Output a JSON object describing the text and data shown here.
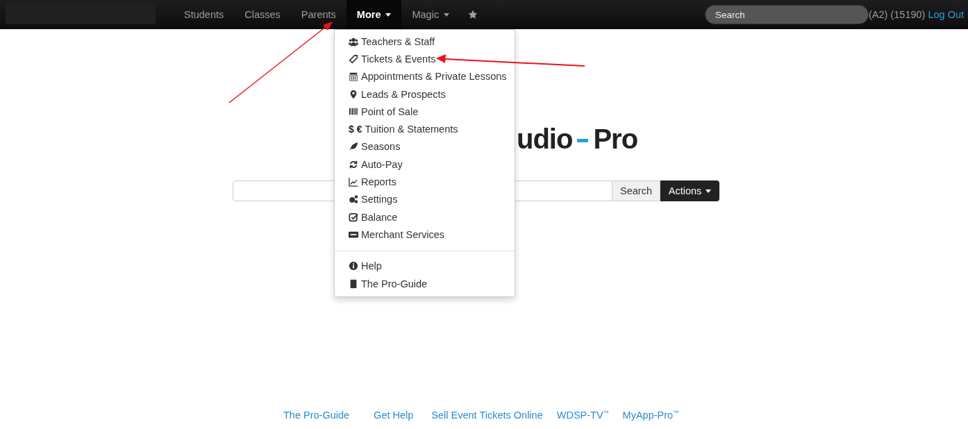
{
  "navbar": {
    "items": [
      {
        "kind": "link",
        "label": "Students",
        "selected": false,
        "caret": false
      },
      {
        "kind": "link",
        "label": "Classes",
        "selected": false,
        "caret": false
      },
      {
        "kind": "link",
        "label": "Parents",
        "selected": false,
        "caret": false
      },
      {
        "kind": "link",
        "label": "More",
        "selected": true,
        "caret": true
      },
      {
        "kind": "link",
        "label": "Magic",
        "selected": false,
        "caret": true
      },
      {
        "kind": "icon",
        "selected": false,
        "caret": false
      }
    ],
    "search": {
      "placeholder": "Search"
    },
    "account": "(A2) (15190)",
    "logout": "Log Out"
  },
  "dropdown": {
    "groups": [
      [
        {
          "label": "Teachers & Staff"
        },
        {
          "label": "Tickets & Events"
        },
        {
          "label": "Appointments & Private Lessons"
        },
        {
          "label": "Leads & Prospects"
        },
        {
          "label": "Point of Sale"
        },
        {
          "icon_text": "$ €",
          "label": "Tuition & Statements"
        },
        {
          "label": "Seasons"
        },
        {
          "label": "Auto-Pay"
        },
        {
          "label": "Reports"
        },
        {
          "label": "Settings"
        },
        {
          "label": "Balance"
        },
        {
          "label": "Merchant Services"
        }
      ],
      [
        {
          "label": "Help"
        },
        {
          "label": "The Pro-Guide"
        }
      ]
    ]
  },
  "logo": {
    "left": "udio",
    "right": "Pro"
  },
  "search_bar": {
    "button": "Search",
    "actions": "Actions"
  },
  "footer": {
    "links": [
      "The Pro-Guide",
      "Get Help",
      "Sell Event Tickets Online",
      "WDSP-TV$^{™}$",
      "MyApp-Pro$^{™}$"
    ]
  }
}
